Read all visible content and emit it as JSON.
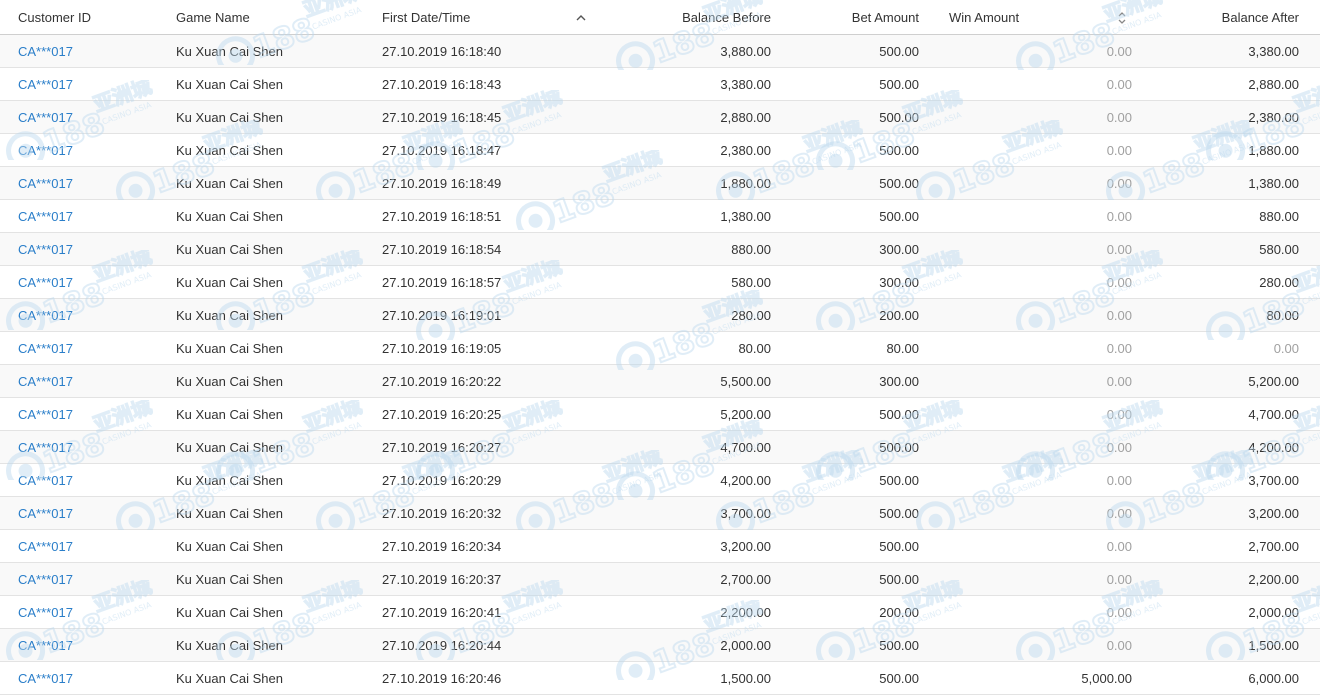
{
  "columns": {
    "customer_id": "Customer ID",
    "game_name": "Game Name",
    "first_datetime": "First Date/Time",
    "balance_before": "Balance Before",
    "bet_amount": "Bet Amount",
    "win_amount": "Win Amount",
    "balance_after": "Balance After"
  },
  "sort": {
    "first_datetime": "ascending",
    "win_amount": "unsorted"
  },
  "colors": {
    "link": "#2a7ec9",
    "zero_value": "#a0a0a0",
    "watermark": "#bcd9ee"
  },
  "icons": {
    "sort_asc": "chevron-up-icon",
    "sort_both": "sort-toggle-icon",
    "watermark": "cc188-casino-asia-logo"
  },
  "watermark": {
    "brand": "CC188",
    "cjk": "亚洲城",
    "sub": "CASINO ASIA"
  },
  "rows": [
    {
      "customer_id": "CA***017",
      "game_name": "Ku Xuan Cai Shen",
      "datetime": "27.10.2019 16:18:40",
      "balance_before": "3,880.00",
      "bet_amount": "500.00",
      "win_amount": "0.00",
      "balance_after": "3,380.00"
    },
    {
      "customer_id": "CA***017",
      "game_name": "Ku Xuan Cai Shen",
      "datetime": "27.10.2019 16:18:43",
      "balance_before": "3,380.00",
      "bet_amount": "500.00",
      "win_amount": "0.00",
      "balance_after": "2,880.00"
    },
    {
      "customer_id": "CA***017",
      "game_name": "Ku Xuan Cai Shen",
      "datetime": "27.10.2019 16:18:45",
      "balance_before": "2,880.00",
      "bet_amount": "500.00",
      "win_amount": "0.00",
      "balance_after": "2,380.00"
    },
    {
      "customer_id": "CA***017",
      "game_name": "Ku Xuan Cai Shen",
      "datetime": "27.10.2019 16:18:47",
      "balance_before": "2,380.00",
      "bet_amount": "500.00",
      "win_amount": "0.00",
      "balance_after": "1,880.00"
    },
    {
      "customer_id": "CA***017",
      "game_name": "Ku Xuan Cai Shen",
      "datetime": "27.10.2019 16:18:49",
      "balance_before": "1,880.00",
      "bet_amount": "500.00",
      "win_amount": "0.00",
      "balance_after": "1,380.00"
    },
    {
      "customer_id": "CA***017",
      "game_name": "Ku Xuan Cai Shen",
      "datetime": "27.10.2019 16:18:51",
      "balance_before": "1,380.00",
      "bet_amount": "500.00",
      "win_amount": "0.00",
      "balance_after": "880.00"
    },
    {
      "customer_id": "CA***017",
      "game_name": "Ku Xuan Cai Shen",
      "datetime": "27.10.2019 16:18:54",
      "balance_before": "880.00",
      "bet_amount": "300.00",
      "win_amount": "0.00",
      "balance_after": "580.00"
    },
    {
      "customer_id": "CA***017",
      "game_name": "Ku Xuan Cai Shen",
      "datetime": "27.10.2019 16:18:57",
      "balance_before": "580.00",
      "bet_amount": "300.00",
      "win_amount": "0.00",
      "balance_after": "280.00"
    },
    {
      "customer_id": "CA***017",
      "game_name": "Ku Xuan Cai Shen",
      "datetime": "27.10.2019 16:19:01",
      "balance_before": "280.00",
      "bet_amount": "200.00",
      "win_amount": "0.00",
      "balance_after": "80.00"
    },
    {
      "customer_id": "CA***017",
      "game_name": "Ku Xuan Cai Shen",
      "datetime": "27.10.2019 16:19:05",
      "balance_before": "80.00",
      "bet_amount": "80.00",
      "win_amount": "0.00",
      "balance_after": "0.00"
    },
    {
      "customer_id": "CA***017",
      "game_name": "Ku Xuan Cai Shen",
      "datetime": "27.10.2019 16:20:22",
      "balance_before": "5,500.00",
      "bet_amount": "300.00",
      "win_amount": "0.00",
      "balance_after": "5,200.00"
    },
    {
      "customer_id": "CA***017",
      "game_name": "Ku Xuan Cai Shen",
      "datetime": "27.10.2019 16:20:25",
      "balance_before": "5,200.00",
      "bet_amount": "500.00",
      "win_amount": "0.00",
      "balance_after": "4,700.00"
    },
    {
      "customer_id": "CA***017",
      "game_name": "Ku Xuan Cai Shen",
      "datetime": "27.10.2019 16:20:27",
      "balance_before": "4,700.00",
      "bet_amount": "500.00",
      "win_amount": "0.00",
      "balance_after": "4,200.00"
    },
    {
      "customer_id": "CA***017",
      "game_name": "Ku Xuan Cai Shen",
      "datetime": "27.10.2019 16:20:29",
      "balance_before": "4,200.00",
      "bet_amount": "500.00",
      "win_amount": "0.00",
      "balance_after": "3,700.00"
    },
    {
      "customer_id": "CA***017",
      "game_name": "Ku Xuan Cai Shen",
      "datetime": "27.10.2019 16:20:32",
      "balance_before": "3,700.00",
      "bet_amount": "500.00",
      "win_amount": "0.00",
      "balance_after": "3,200.00"
    },
    {
      "customer_id": "CA***017",
      "game_name": "Ku Xuan Cai Shen",
      "datetime": "27.10.2019 16:20:34",
      "balance_before": "3,200.00",
      "bet_amount": "500.00",
      "win_amount": "0.00",
      "balance_after": "2,700.00"
    },
    {
      "customer_id": "CA***017",
      "game_name": "Ku Xuan Cai Shen",
      "datetime": "27.10.2019 16:20:37",
      "balance_before": "2,700.00",
      "bet_amount": "500.00",
      "win_amount": "0.00",
      "balance_after": "2,200.00"
    },
    {
      "customer_id": "CA***017",
      "game_name": "Ku Xuan Cai Shen",
      "datetime": "27.10.2019 16:20:41",
      "balance_before": "2,200.00",
      "bet_amount": "200.00",
      "win_amount": "0.00",
      "balance_after": "2,000.00"
    },
    {
      "customer_id": "CA***017",
      "game_name": "Ku Xuan Cai Shen",
      "datetime": "27.10.2019 16:20:44",
      "balance_before": "2,000.00",
      "bet_amount": "500.00",
      "win_amount": "0.00",
      "balance_after": "1,500.00"
    },
    {
      "customer_id": "CA***017",
      "game_name": "Ku Xuan Cai Shen",
      "datetime": "27.10.2019 16:20:46",
      "balance_before": "1,500.00",
      "bet_amount": "500.00",
      "win_amount": "5,000.00",
      "balance_after": "6,000.00"
    }
  ]
}
